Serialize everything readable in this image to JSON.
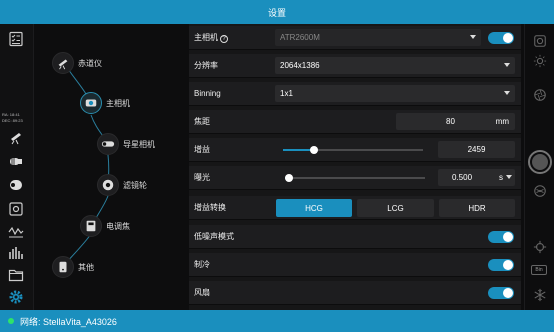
{
  "window": {
    "title": "设置"
  },
  "status": {
    "text": "网络: StellaVita_A43026"
  },
  "left": {
    "ra": "RA: 18:41",
    "dec": "DEC: 89:23"
  },
  "tree": {
    "equatorial": "赤道仪",
    "main_camera": "主相机",
    "guide_camera": "导星相机",
    "filter_wheel": "滤镜轮",
    "focuser": "电调焦",
    "other": "其他"
  },
  "settings": {
    "main_camera": {
      "label": "主相机",
      "value": "ATR2600M",
      "enabled": true
    },
    "resolution": {
      "label": "分辨率",
      "value": "2064x1386"
    },
    "binning": {
      "label": "Binning",
      "value": "1x1"
    },
    "focal": {
      "label": "焦距",
      "value": "80",
      "unit": "mm"
    },
    "gain": {
      "label": "增益",
      "value": "2459",
      "slider_fraction": 0.22
    },
    "exposure": {
      "label": "曝光",
      "value": "0.500",
      "unit": "s",
      "slider_fraction": 0.03
    },
    "gain_mode": {
      "label": "增益转换",
      "options": [
        "HCG",
        "LCG",
        "HDR"
      ],
      "selected": "HCG"
    },
    "low_noise": {
      "label": "低噪声模式",
      "enabled": true
    },
    "cooling": {
      "label": "制冷",
      "enabled": true
    },
    "fan": {
      "label": "风扇",
      "enabled": true
    }
  },
  "right": {
    "bin_badge": "Bin"
  },
  "colors": {
    "accent": "#1a8fbe",
    "status_ok": "#2ee36a"
  }
}
